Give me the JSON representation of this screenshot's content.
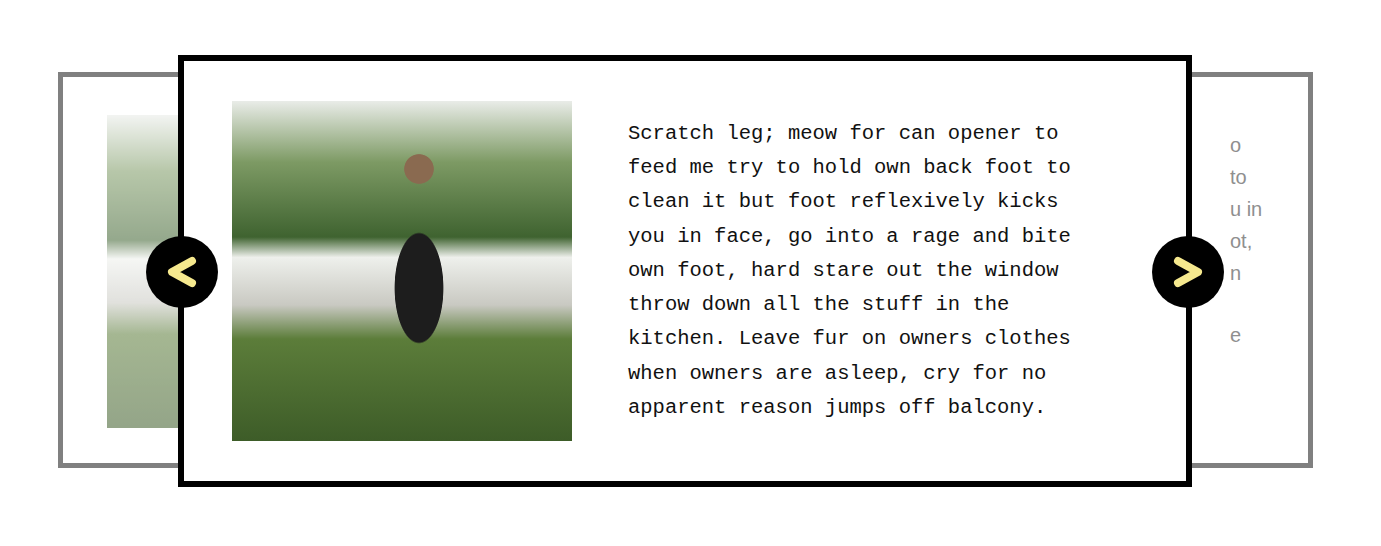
{
  "carousel": {
    "previous_card": {
      "selected": false,
      "has_photo": true
    },
    "current_card": {
      "selected": true,
      "has_photo": true,
      "quote": "Scratch leg; meow for can opener to feed me try to hold own back foot to clean it but foot reflexively kicks you in face, go into a rage and bite own foot, hard stare out the window throw down all the stuff in the kitchen. Leave fur on owners clothes when owners are asleep, cry for no apparent reason jumps off balcony."
    },
    "next_card": {
      "selected": false,
      "quote_fragments": [
        "o",
        "to",
        "u in",
        "ot,",
        "n",
        "e"
      ]
    },
    "controls": [
      {
        "direction": "previous",
        "disabled": false
      },
      {
        "direction": "next",
        "disabled": false
      }
    ]
  }
}
